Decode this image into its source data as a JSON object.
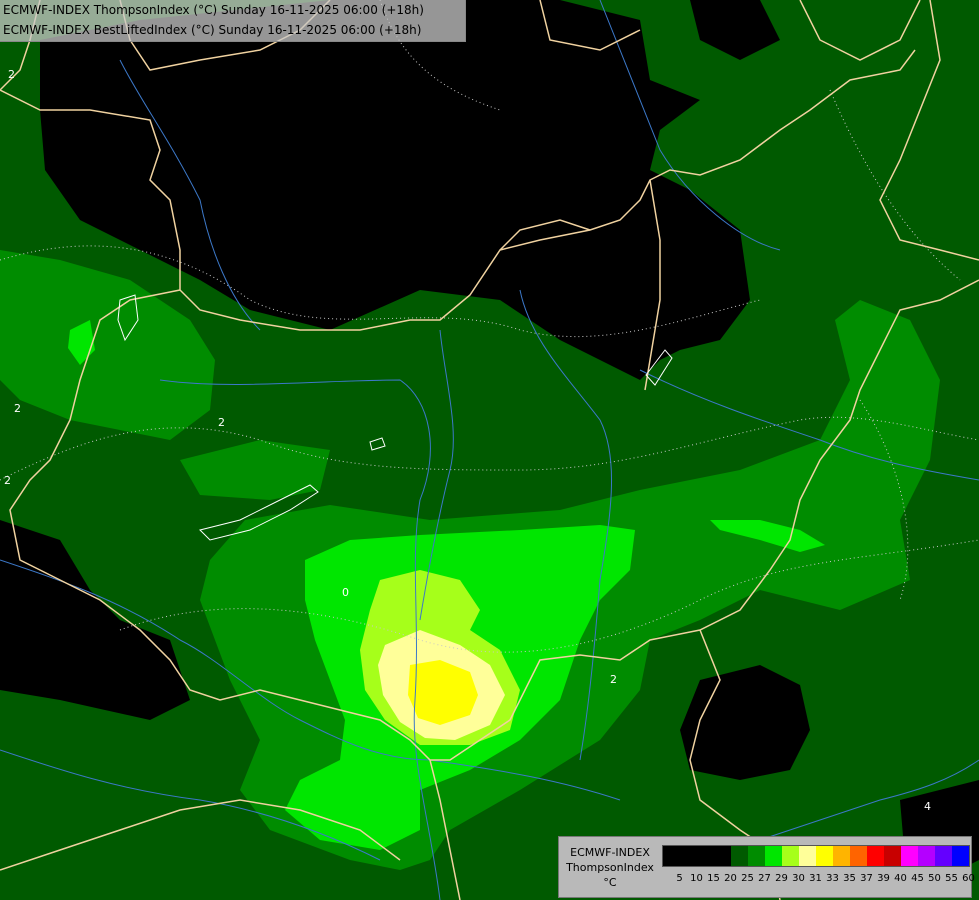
{
  "titles": {
    "line1": "ECMWF-INDEX ThompsonIndex (°C) Sunday 16-11-2025 06:00 (+18h)",
    "line2": "ECMWF-INDEX BestLiftedIndex (°C) Sunday 16-11-2025 06:00 (+18h)"
  },
  "legend": {
    "model": "ECMWF-INDEX",
    "parameter": "ThompsonIndex",
    "unit": "°C",
    "scale": [
      {
        "value": "5",
        "color": "#000000"
      },
      {
        "value": "10",
        "color": "#000000"
      },
      {
        "value": "15",
        "color": "#000000"
      },
      {
        "value": "20",
        "color": "#000000"
      },
      {
        "value": "25",
        "color": "#005a00"
      },
      {
        "value": "27",
        "color": "#008c00"
      },
      {
        "value": "29",
        "color": "#00e600"
      },
      {
        "value": "30",
        "color": "#a6ff1a"
      },
      {
        "value": "31",
        "color": "#ffff99"
      },
      {
        "value": "33",
        "color": "#ffff00"
      },
      {
        "value": "35",
        "color": "#ffb400"
      },
      {
        "value": "37",
        "color": "#ff6400"
      },
      {
        "value": "39",
        "color": "#ff0000"
      },
      {
        "value": "40",
        "color": "#c80000"
      },
      {
        "value": "45",
        "color": "#ff00ff"
      },
      {
        "value": "50",
        "color": "#b400ff"
      },
      {
        "value": "55",
        "color": "#6400ff"
      },
      {
        "value": "60",
        "color": "#0000ff"
      }
    ]
  },
  "contour_labels": [
    "2",
    "2",
    "2",
    "2",
    "0",
    "2",
    "4"
  ],
  "colors": {
    "border": "#f0d2a0",
    "river": "#3c78c8",
    "lake_outline": "#ffffff",
    "contour": "#c8c8c8"
  }
}
